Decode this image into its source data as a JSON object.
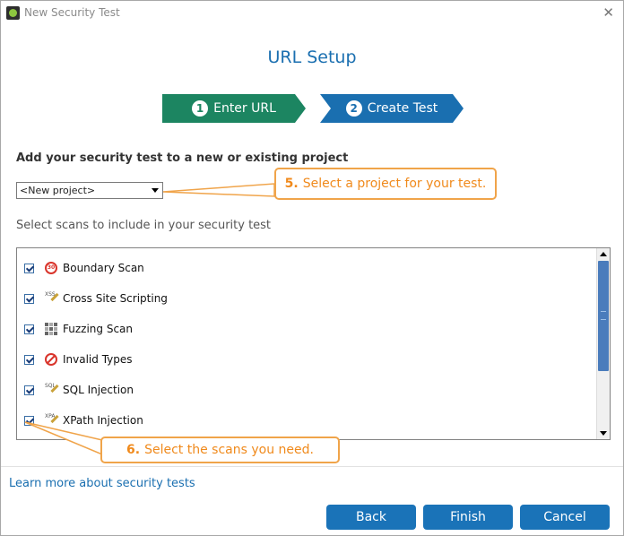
{
  "window": {
    "title": "New Security Test",
    "close_glyph": "✕"
  },
  "heading": "URL Setup",
  "steps": [
    {
      "num": "1",
      "label": "Enter URL",
      "color": "#1c8561"
    },
    {
      "num": "2",
      "label": "Create Test",
      "color": "#1a6fb0"
    }
  ],
  "project": {
    "label": "Add your security test to a new or existing project",
    "selected": "<New project>"
  },
  "scans": {
    "label": "Select scans to include in your security test",
    "items": [
      {
        "label": "Boundary Scan",
        "icon": "boundary-scan-icon",
        "icon_text": "30",
        "checked": true
      },
      {
        "label": "Cross Site Scripting",
        "icon": "cross-site-scripting-icon",
        "icon_text": "XSS",
        "checked": true
      },
      {
        "label": "Fuzzing Scan",
        "icon": "fuzzing-scan-icon",
        "checked": true
      },
      {
        "label": "Invalid Types",
        "icon": "invalid-types-icon",
        "checked": true
      },
      {
        "label": "SQL Injection",
        "icon": "sql-injection-icon",
        "icon_text": "SQL",
        "checked": true
      },
      {
        "label": "XPath Injection",
        "icon": "xpath-injection-icon",
        "icon_text": "XPA",
        "checked": true
      }
    ]
  },
  "callouts": [
    {
      "num": "5.",
      "text": "Select a project for your test."
    },
    {
      "num": "6.",
      "text": "Select the scans you need."
    }
  ],
  "learn_more": "Learn more about security tests",
  "buttons": {
    "back": "Back",
    "finish": "Finish",
    "cancel": "Cancel"
  },
  "colors": {
    "accent": "#1a6fb0",
    "step_done": "#1c8561",
    "callout": "#f0a44a",
    "callout_text": "#f08a1c"
  }
}
